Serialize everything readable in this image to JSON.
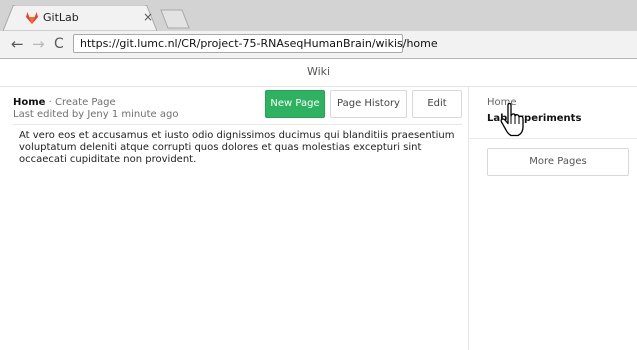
{
  "browser": {
    "tab_title": "GitLab",
    "tab_close": "×",
    "url": "https://git.lumc.nl/CR/project-75-RNAseqHumanBrain/wikis/home"
  },
  "page": {
    "title": "Wiki"
  },
  "header": {
    "page_name": "Home",
    "separator": " · ",
    "create_link": "Create Page",
    "last_edited": "Last edited by Jeny 1 minute ago",
    "buttons": {
      "new_page": "New Page",
      "page_history": "Page History",
      "edit": "Edit"
    }
  },
  "content": {
    "body": "At vero eos et accusamus et iusto odio dignissimos ducimus qui blanditiis praesentium voluptatum deleniti atque corrupti quos dolores et quas molestias excepturi sint occaecati cupiditate non provident."
  },
  "sidebar": {
    "items": [
      {
        "label": "Home"
      },
      {
        "label": "Lab Experiments"
      }
    ],
    "more_pages": "More Pages"
  },
  "colors": {
    "primary_button": "#2db35f",
    "gitlab_orange": "#e24329"
  }
}
